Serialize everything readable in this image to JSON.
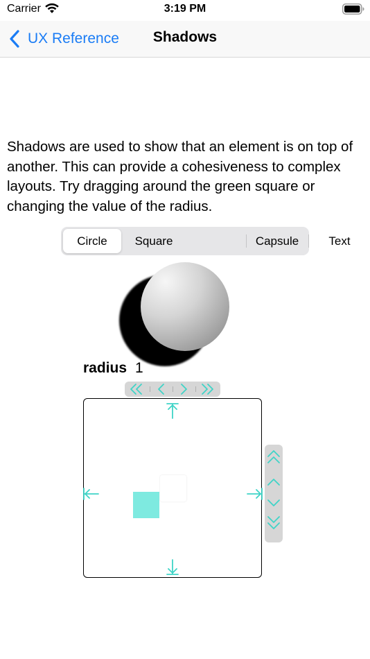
{
  "status_bar": {
    "carrier": "Carrier",
    "time": "3:19 PM",
    "icons": [
      "wifi-icon",
      "battery-icon"
    ]
  },
  "nav": {
    "back_label": "UX Reference",
    "title": "Shadows",
    "back_icon": "chevron-left-icon"
  },
  "description": "Shadows are used to show that an element is on top of another. This can provide a cohesiveness to complex layouts. Try dragging around the green square or changing the value of the radius.",
  "segmented": {
    "options": [
      "Circle",
      "Square",
      "Capsule",
      "Text"
    ],
    "selected": "Circle"
  },
  "radius": {
    "label": "radius",
    "value": "1"
  },
  "steppers": {
    "horizontal": [
      "double-chevron-left-icon",
      "chevron-left-icon",
      "chevron-right-icon",
      "double-chevron-right-icon"
    ],
    "vertical": [
      "double-chevron-up-icon",
      "chevron-up-icon",
      "chevron-down-icon",
      "double-chevron-down-icon"
    ]
  },
  "canvas": {
    "edge_arrows": [
      "arrow-to-top-icon",
      "arrow-to-left-icon",
      "arrow-to-right-icon",
      "arrow-to-bottom-icon"
    ]
  },
  "colors": {
    "accent": "#1a7cf5",
    "drag_square": "#7eeae0",
    "arrow": "#3fd4c7"
  }
}
